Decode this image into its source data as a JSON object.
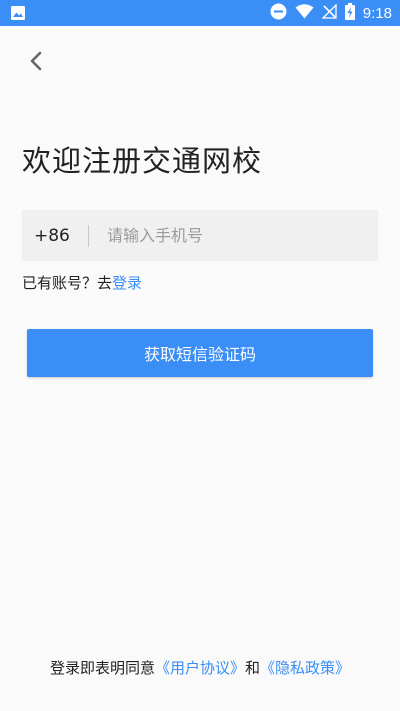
{
  "status_bar": {
    "time": "9:18",
    "icons": [
      "image-icon",
      "dnd-icon",
      "wifi-icon",
      "no-signal-icon",
      "battery-charging-icon"
    ]
  },
  "header": {
    "back_icon": "chevron-left-icon"
  },
  "page": {
    "title": "欢迎注册交通网校"
  },
  "phone": {
    "country_code": "+86",
    "placeholder": "请输入手机号",
    "value": ""
  },
  "login_hint": {
    "prefix": "已有账号？去",
    "link": "登录"
  },
  "actions": {
    "sms_button_label": "获取短信验证码"
  },
  "agreement": {
    "prefix": "登录即表明同意",
    "user_agreement": "《用户协议》",
    "and": "和",
    "privacy_policy": "《隐私政策》"
  },
  "colors": {
    "accent": "#3a8ef6",
    "background": "#fafafa",
    "input_background": "#f0f0f0"
  }
}
